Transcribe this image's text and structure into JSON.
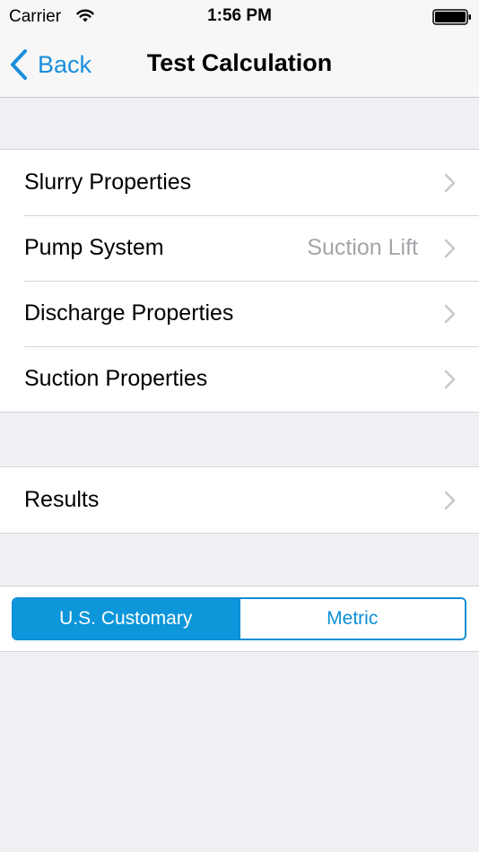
{
  "status_bar": {
    "carrier": "Carrier",
    "time": "1:56 PM",
    "wifi_icon": "wifi-icon",
    "battery_icon": "battery-icon"
  },
  "nav": {
    "back_label": "Back",
    "back_icon": "chevron-left-icon",
    "title": "Test Calculation"
  },
  "sections": {
    "inputs": [
      {
        "label": "Slurry Properties",
        "detail": ""
      },
      {
        "label": "Pump System",
        "detail": "Suction Lift"
      },
      {
        "label": "Discharge Properties",
        "detail": ""
      },
      {
        "label": "Suction Properties",
        "detail": ""
      }
    ],
    "results": [
      {
        "label": "Results",
        "detail": ""
      }
    ]
  },
  "units": {
    "options": [
      "U.S. Customary",
      "Metric"
    ],
    "selected": "U.S. Customary"
  },
  "colors": {
    "accent": "#0d96d9",
    "background": "#efeff4",
    "detail_text": "#a4a4aa",
    "chevron": "#c7c7cc"
  }
}
